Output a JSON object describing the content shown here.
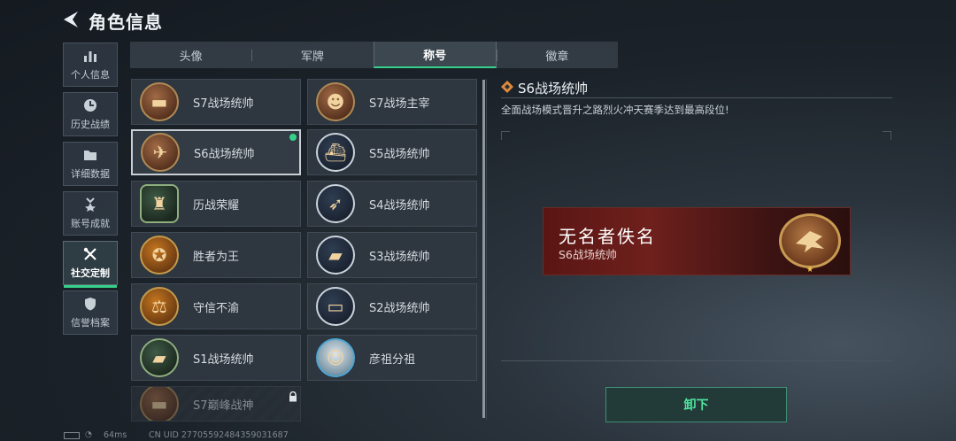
{
  "header": {
    "title": "角色信息"
  },
  "sidebar": {
    "items": [
      {
        "label": "个人信息",
        "icon": "bar-chart-icon"
      },
      {
        "label": "历史战绩",
        "icon": "clock-icon"
      },
      {
        "label": "详细数据",
        "icon": "folder-icon"
      },
      {
        "label": "账号成就",
        "icon": "medal-icon"
      },
      {
        "label": "社交定制",
        "icon": "tools-icon",
        "active": true
      },
      {
        "label": "信誉档案",
        "icon": "shield-icon"
      }
    ]
  },
  "tabs": [
    {
      "label": "头像"
    },
    {
      "label": "军牌"
    },
    {
      "label": "称号",
      "active": true
    },
    {
      "label": "徽章"
    }
  ],
  "titles": [
    {
      "name": "S7战场统帅",
      "icon": "vehicle-badge-icon"
    },
    {
      "name": "S7战场主宰",
      "icon": "soldier-badge-icon"
    },
    {
      "name": "S6战场统帅",
      "icon": "jet-badge-icon",
      "selected": true,
      "equipped": true
    },
    {
      "name": "S5战场统帅",
      "icon": "boat-badge-icon"
    },
    {
      "name": "历战荣耀",
      "icon": "trophy-badge-icon"
    },
    {
      "name": "S4战场统帅",
      "icon": "missile-badge-icon"
    },
    {
      "name": "胜者为王",
      "icon": "medal-badge-icon"
    },
    {
      "name": "S3战场统帅",
      "icon": "tank-badge-icon"
    },
    {
      "name": "守信不渝",
      "icon": "scales-badge-icon"
    },
    {
      "name": "S2战场统帅",
      "icon": "truck-badge-icon"
    },
    {
      "name": "S1战场统帅",
      "icon": "tank-badge-icon"
    },
    {
      "name": "彦祖分祖",
      "icon": "portrait-badge-icon"
    },
    {
      "name": "S7巅峰战神",
      "icon": "vehicle-badge-icon",
      "locked": true
    }
  ],
  "detail": {
    "title": "S6战场统帅",
    "description": "全面战场模式晋升之路烈火冲天赛季达到最高段位!",
    "banner_name": "无名者佚名",
    "banner_title": "S6战场统帅",
    "action_label": "卸下"
  },
  "status": {
    "ping": "64ms",
    "uid": "CN UID 27705592484359031687"
  },
  "colors": {
    "accent": "#35d08a",
    "banner": "#6e201c",
    "badge_gold": "#c89a52"
  }
}
